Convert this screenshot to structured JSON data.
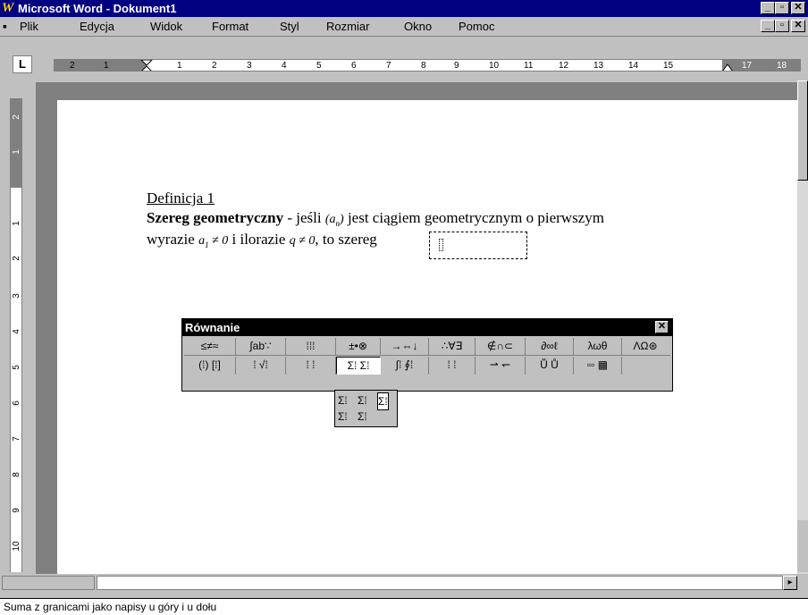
{
  "window": {
    "app_icon": "W",
    "title": "Microsoft Word - Dokument1",
    "min_glyph": "_",
    "restore_glyph": "▫",
    "close_glyph": "✕"
  },
  "menu": {
    "doc_icon": "▪",
    "items": [
      "Plik",
      "Edycja",
      "Widok",
      "Format",
      "Styl",
      "Rozmiar",
      "Okno",
      "Pomoc"
    ]
  },
  "ruler": {
    "tab_selector": "L",
    "h_labels": [
      "2",
      "1",
      "1",
      "2",
      "3",
      "4",
      "5",
      "6",
      "7",
      "8",
      "9",
      "10",
      "11",
      "12",
      "13",
      "14",
      "15",
      "17",
      "18"
    ],
    "v_labels": [
      "2",
      "1",
      "1",
      "2",
      "3",
      "4",
      "5",
      "6",
      "7",
      "8",
      "9",
      "10"
    ]
  },
  "document": {
    "heading": "Definicja 1",
    "bold_term": "Szereg geometryczny",
    "line1_a": " -  jeśli ",
    "seq": "(a",
    "seq_sub": "n",
    "seq_close": ")",
    "line1_b": " jest ciągiem geometrycznym o pierwszym",
    "line2_a": "wyrazie ",
    "a1": "a",
    "a1_sub": "1",
    "a1_rest": " ≠ 0",
    "line2_b": " i ilorazie ",
    "q": "q ≠ 0",
    "line2_c": ", to szereg"
  },
  "palette": {
    "title": "Równanie",
    "close_glyph": "✕",
    "row1": [
      "≤≠≈",
      "∫ab∵",
      "⁞⁞⁞",
      "±•⊗",
      "→⇔↓",
      "∴∀∃",
      "∉∩⊂",
      "∂∞ℓ",
      "λωθ",
      "ΛΩ⊛"
    ],
    "row2": [
      "(⁞) [⁞]",
      "⁞ √⁞",
      "⁞ ⁞",
      "Σ⁞ Σ⁞",
      "∫⁞ ∮⁞",
      "⁞ ⁞",
      "⇀ ↽",
      "Ṻ Ů",
      "▫▫ ▦"
    ],
    "dropdown": {
      "row1": [
        "Σ⁞",
        "Σ⁞",
        "Σ⁞"
      ],
      "row2": [
        "Σ⁞",
        "Σ⁞"
      ]
    }
  },
  "statusbar": {
    "text": "Suma z granicami jako napisy u góry i u dołu"
  },
  "colors": {
    "titlebar": "#000080",
    "face": "#c0c0c0",
    "page": "#ffffff"
  }
}
